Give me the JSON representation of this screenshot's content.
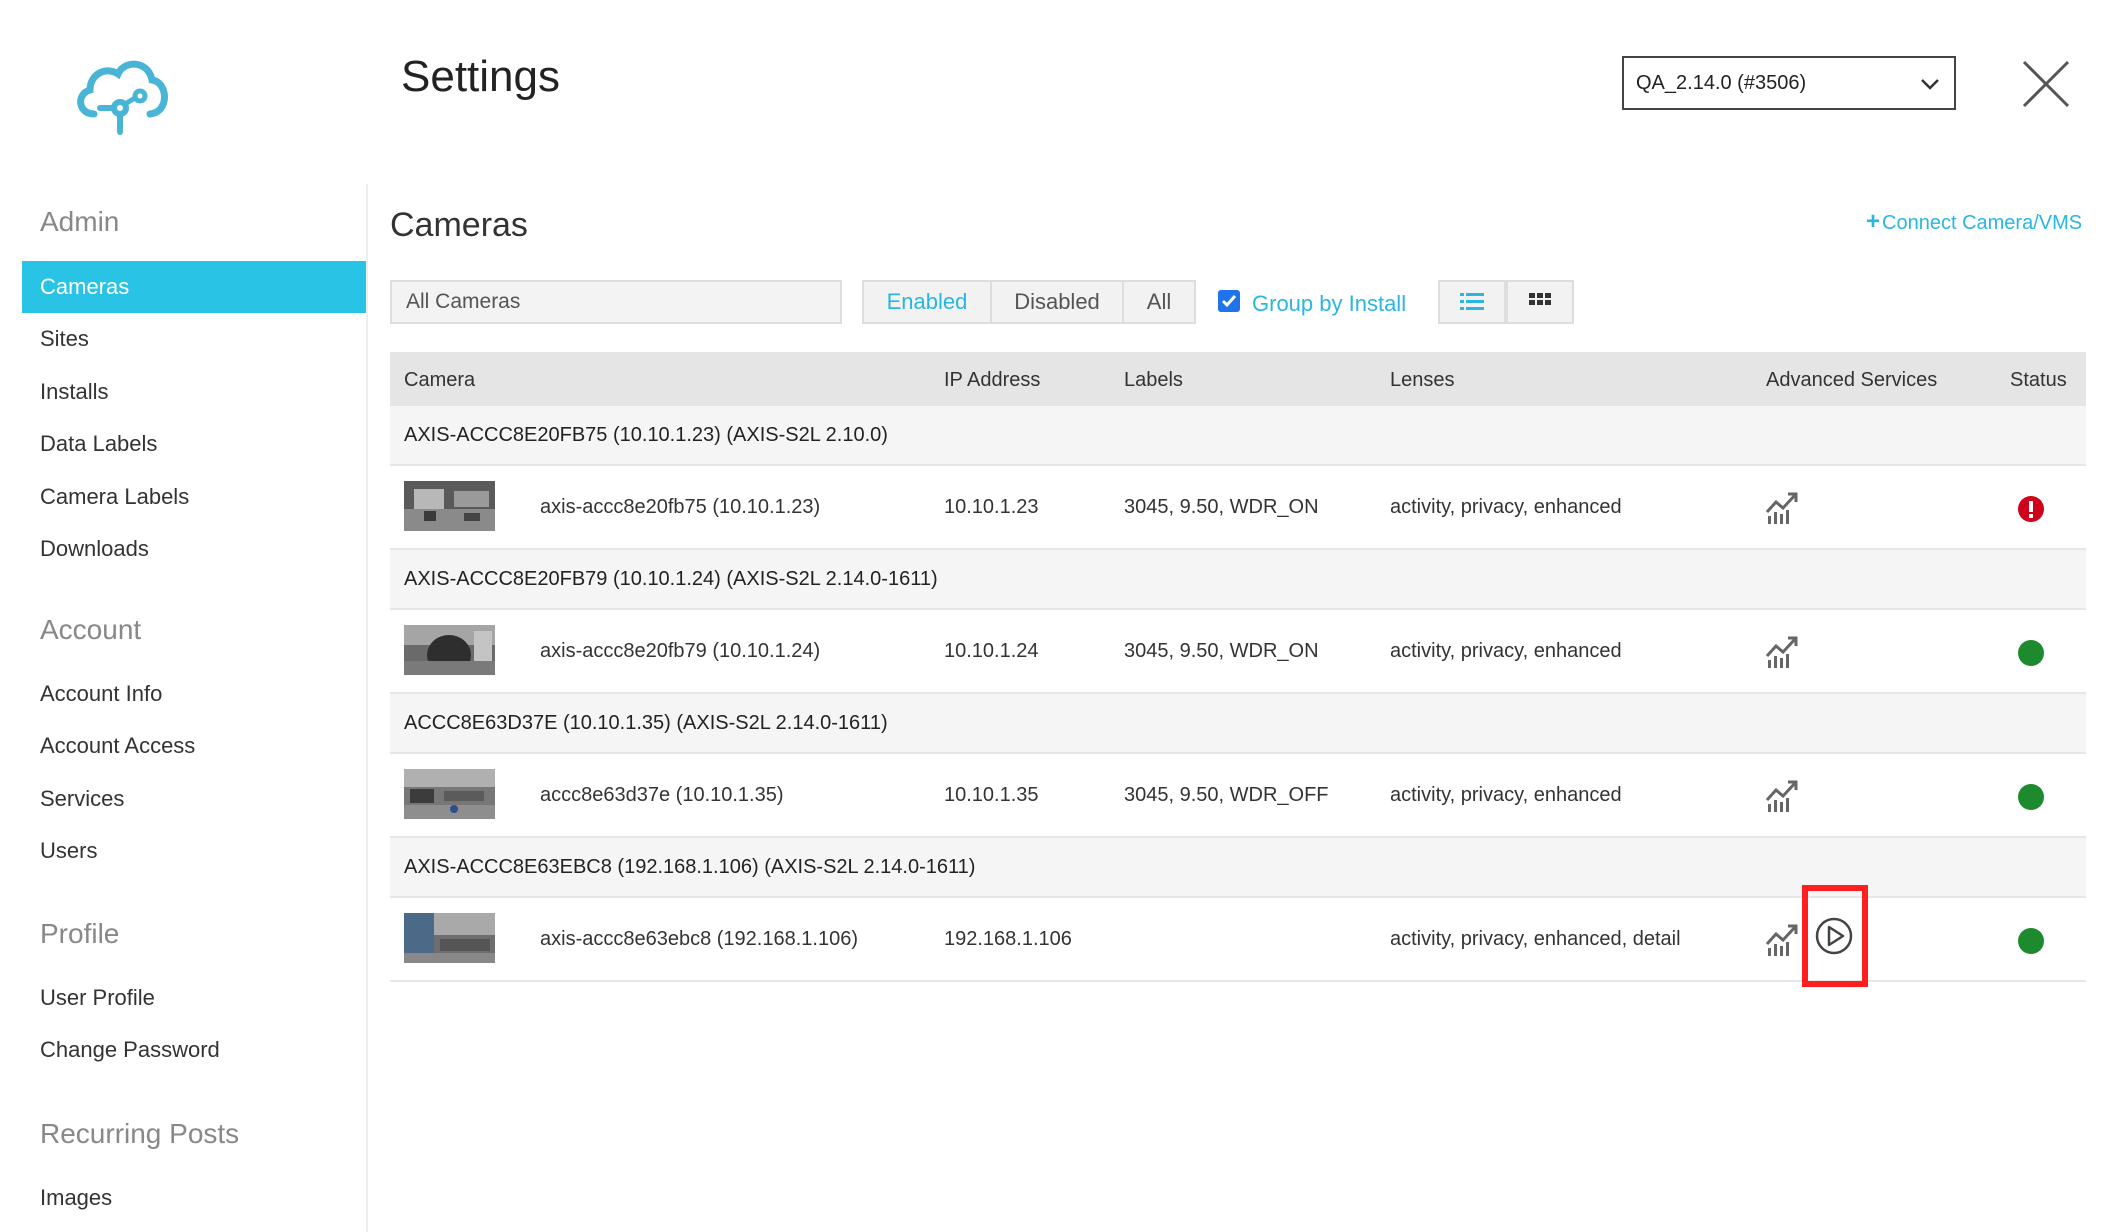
{
  "header": {
    "title": "Settings",
    "version_selected": "QA_2.14.0 (#3506)",
    "logo_icon": "cloud-network-icon",
    "close_icon": "close-icon"
  },
  "sidebar": {
    "sections": [
      {
        "title": "Admin",
        "items": [
          "Cameras",
          "Sites",
          "Installs",
          "Data Labels",
          "Camera Labels",
          "Downloads"
        ]
      },
      {
        "title": "Account",
        "items": [
          "Account Info",
          "Account Access",
          "Services",
          "Users"
        ]
      },
      {
        "title": "Profile",
        "items": [
          "User Profile",
          "Change Password"
        ]
      },
      {
        "title": "Recurring Posts",
        "items": [
          "Images"
        ]
      }
    ],
    "active_item": "Cameras"
  },
  "main": {
    "title": "Cameras",
    "connect_label": "Connect Camera/VMS",
    "filter_value": "All Cameras",
    "segments": [
      "Enabled",
      "Disabled",
      "All"
    ],
    "active_segment": "Enabled",
    "group_by_label": "Group by Install",
    "group_by_checked": true,
    "columns": [
      "Camera",
      "IP Address",
      "Labels",
      "Lenses",
      "Advanced Services",
      "Status"
    ]
  },
  "groups": [
    {
      "title": "AXIS-ACCC8E20FB75 (10.10.1.23) (AXIS-S2L 2.10.0)",
      "camera": {
        "name": "axis-accc8e20fb75 (10.10.1.23)",
        "ip": "10.10.1.23",
        "labels": "3045, 9.50, WDR_ON",
        "lenses": "activity, privacy, enhanced",
        "status": "error"
      }
    },
    {
      "title": "AXIS-ACCC8E20FB79 (10.10.1.24) (AXIS-S2L 2.14.0-1611)",
      "camera": {
        "name": "axis-accc8e20fb79 (10.10.1.24)",
        "ip": "10.10.1.24",
        "labels": "3045, 9.50, WDR_ON",
        "lenses": "activity, privacy, enhanced",
        "status": "ok"
      }
    },
    {
      "title": "ACCC8E63D37E (10.10.1.35) (AXIS-S2L 2.14.0-1611)",
      "camera": {
        "name": "accc8e63d37e (10.10.1.35)",
        "ip": "10.10.1.35",
        "labels": "3045, 9.50, WDR_OFF",
        "lenses": "activity, privacy, enhanced",
        "status": "ok"
      }
    },
    {
      "title": "AXIS-ACCC8E63EBC8 (192.168.1.106) (AXIS-S2L 2.14.0-1611)",
      "camera": {
        "name": "axis-accc8e63ebc8 (192.168.1.106)",
        "ip": "192.168.1.106",
        "labels": "",
        "lenses": "activity, privacy, enhanced, detail",
        "status": "ok",
        "has_play": true
      }
    }
  ],
  "colors": {
    "accent": "#29c3e5",
    "status_ok": "#1d8a2d",
    "status_error": "#d0021b",
    "highlight": "#ff1f1f"
  }
}
